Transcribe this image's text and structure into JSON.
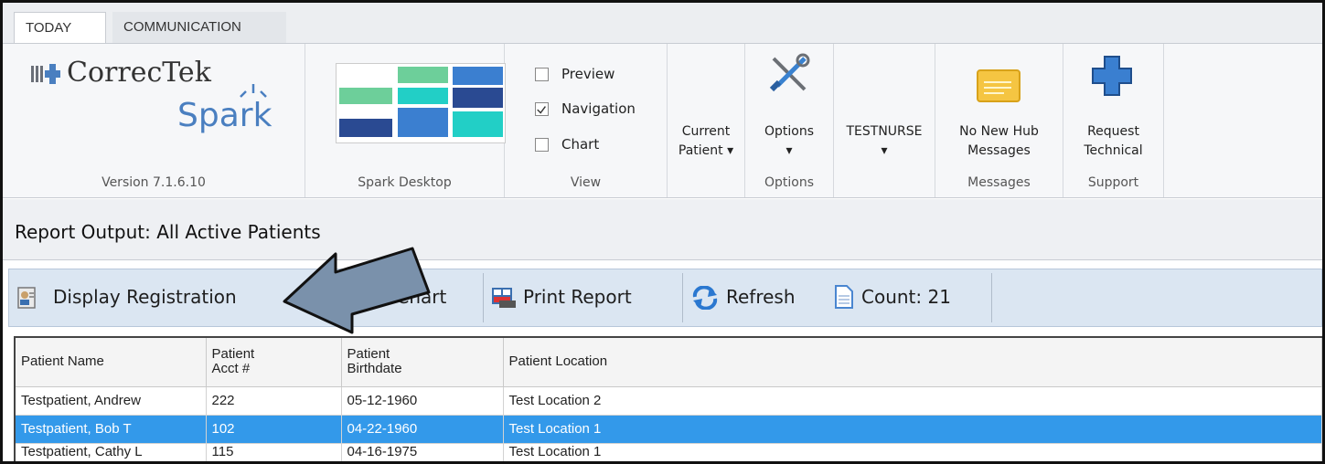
{
  "tabs": [
    {
      "label": "TODAY",
      "active": true
    },
    {
      "label": "COMMUNICATION",
      "active": false
    }
  ],
  "ribbon": {
    "logo_text": "CorrecTek",
    "logo_sub": "Spark",
    "version_group_label": "Version 7.1.6.10",
    "desktop_group_label": "Spark Desktop",
    "view": {
      "checkboxes": [
        {
          "label": "Preview",
          "checked": false
        },
        {
          "label": "Navigation",
          "checked": true
        },
        {
          "label": "Chart",
          "checked": false
        }
      ],
      "group_label": "View"
    },
    "current_patient": {
      "line1": "Current",
      "line2": "Patient ▾"
    },
    "options": {
      "label": "Options",
      "arrow": "▾",
      "group_label": "Options"
    },
    "user": {
      "label": "TESTNURSE",
      "arrow": "▾"
    },
    "messages": {
      "line1": "No New Hub",
      "line2": "Messages",
      "group_label": "Messages"
    },
    "support": {
      "line1": "Request",
      "line2": "Technical",
      "group_label": "Support"
    }
  },
  "report": {
    "title": "Report Output: All Active Patients"
  },
  "toolbar": {
    "display_registration": "Display Registration",
    "print_chart": "Print Chart",
    "print_report": "Print Report",
    "refresh": "Refresh",
    "count": "Count: 21"
  },
  "grid": {
    "columns": [
      {
        "line1": "Patient Name",
        "line2": ""
      },
      {
        "line1": "Patient",
        "line2": "Acct #"
      },
      {
        "line1": "Patient",
        "line2": "Birthdate"
      },
      {
        "line1": "Patient Location",
        "line2": ""
      }
    ],
    "rows": [
      {
        "name": "Testpatient, Andrew",
        "acct": "222",
        "birthdate": "05-12-1960",
        "location": "Test Location 2",
        "selected": false
      },
      {
        "name": "Testpatient, Bob T",
        "acct": "102",
        "birthdate": "04-22-1960",
        "location": "Test Location 1",
        "selected": true
      },
      {
        "name": "Testpatient, Cathy L",
        "acct": "115",
        "birthdate": "04-16-1975",
        "location": "Test Location 1",
        "selected": false
      }
    ]
  },
  "colors": {
    "selection": "#3399ea",
    "toolbar_bg": "#dbe6f2",
    "arrow_fill": "#7a91ab",
    "logo_blue": "#4a7fc0"
  },
  "icons": {
    "options": "tools-icon",
    "messages": "envelope-icon",
    "support": "medical-cross-icon",
    "display_registration": "registration-icon",
    "print_report": "print-report-icon",
    "refresh": "refresh-icon",
    "count": "document-icon"
  }
}
